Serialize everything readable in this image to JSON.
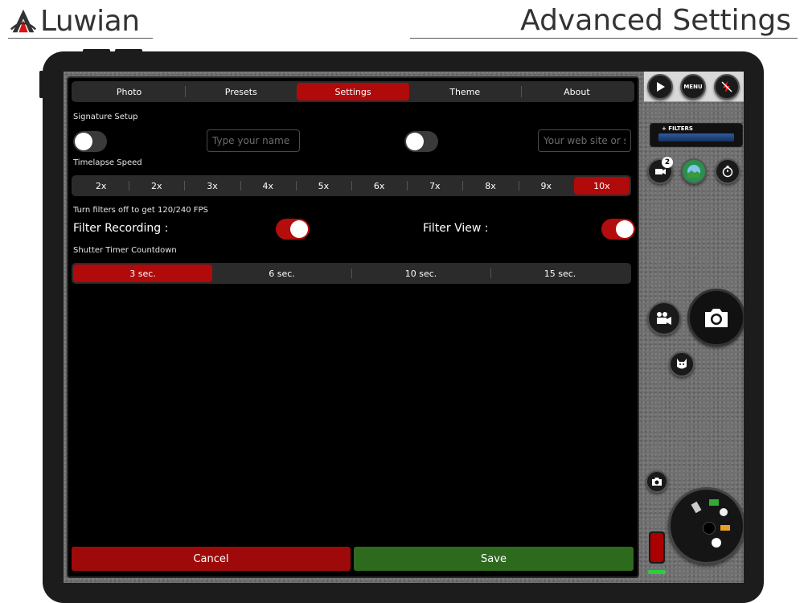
{
  "brand": {
    "name": "Luwian"
  },
  "page_title": "Advanced Settings",
  "tabs": [
    {
      "label": "Photo",
      "active": false
    },
    {
      "label": "Presets",
      "active": false
    },
    {
      "label": "Settings",
      "active": true
    },
    {
      "label": "Theme",
      "active": false
    },
    {
      "label": "About",
      "active": false
    }
  ],
  "signature": {
    "section_label": "Signature Setup",
    "name_placeholder": "Type your name",
    "website_placeholder": "Your web site or s...",
    "name_toggle_on": false,
    "website_toggle_on": false
  },
  "timelapse": {
    "section_label": "Timelapse Speed",
    "options": [
      "2x",
      "2x",
      "3x",
      "4x",
      "5x",
      "6x",
      "7x",
      "8x",
      "9x",
      "10x"
    ],
    "selected_index": 9
  },
  "filters_note": "Turn filters off to get 120/240 FPS",
  "filter_recording": {
    "label": "Filter Recording :",
    "on": true
  },
  "filter_view": {
    "label": "Filter View :",
    "on": true
  },
  "shutter": {
    "section_label": "Shutter Timer Countdown",
    "options": [
      "3 sec.",
      "6 sec.",
      "10 sec.",
      "15 sec."
    ],
    "selected_index": 0
  },
  "actions": {
    "cancel": "Cancel",
    "save": "Save"
  },
  "camera_controls": {
    "menu_label": "MENU",
    "filters_label": "+ FILTERS",
    "badge_count": "2"
  },
  "colors": {
    "accent_red": "#b00a0a",
    "save_green": "#2d6a1e",
    "panel_bg": "#000000"
  }
}
